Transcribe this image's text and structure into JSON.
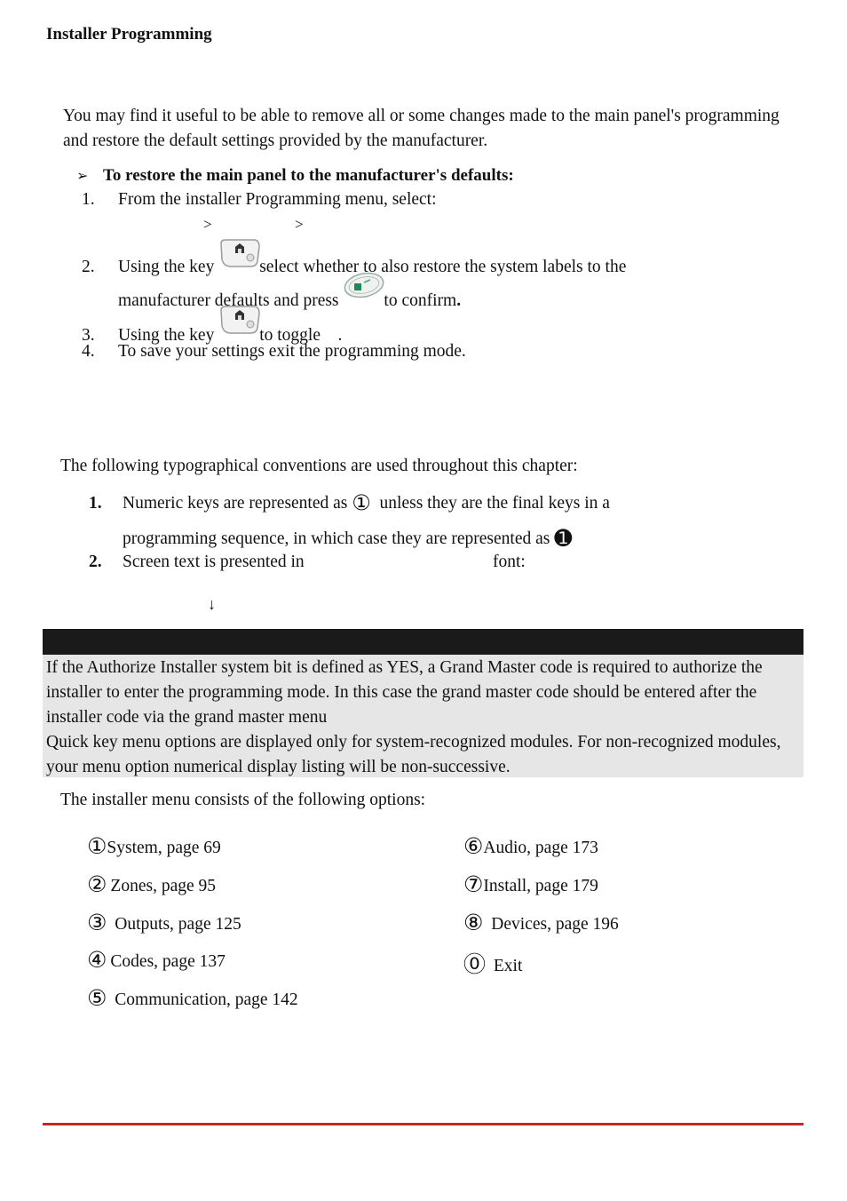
{
  "header": {
    "title": "Installer Programming"
  },
  "intro_paragraph": "You may find it useful to be able to remove all or some changes made to the main panel's programming and restore the default settings provided by the manufacturer.",
  "procedure": {
    "bullet_icon": "arrowhead-bullet",
    "bullet": "➢",
    "title": "To restore the main panel to the manufacturer's defaults:",
    "steps": [
      {
        "num": "1.",
        "text": "From the installer Programming menu, select:",
        "path_separators": [
          ">",
          ">"
        ]
      },
      {
        "num": "2.",
        "text_a": "Using the key",
        "key_icon": "home-key-icon",
        "text_b": "select whether to also restore the system labels to the",
        "text_c": "manufacturer defaults and press",
        "confirm_icon": "ok-key-icon",
        "text_d": "to confirm",
        "text_e": "."
      },
      {
        "num": "3.",
        "text_a": "Using  the key",
        "key_icon": "home-key-icon",
        "text_b": "to toggle",
        "text_c": "."
      },
      {
        "num": "4.",
        "text": "To save your settings exit the programming mode."
      }
    ]
  },
  "conventions": {
    "intro": "The following typographical conventions are used throughout this chapter:",
    "items": [
      {
        "num": "1.",
        "text_a": "Numeric keys are represented as",
        "symbol_a": "①",
        "text_b": "unless they are the final keys in a",
        "text_c": "programming sequence, in which case they are represented as",
        "symbol_b": "➊"
      },
      {
        "num": "2.",
        "text_a": "Screen text is presented in",
        "text_b": "font:"
      }
    ],
    "down_arrow": "↓"
  },
  "note": {
    "lines": [
      "If the Authorize Installer system bit is defined as YES, a Grand Master code is required to authorize the installer to enter the programming mode. In this case the grand master code should be entered after the installer code via the grand master menu",
      "Quick key menu options are displayed only for system-recognized modules. For non-recognized modules, your menu option numerical display listing will be non-successive."
    ]
  },
  "menu": {
    "intro": "The installer menu consists of the following options:",
    "left": [
      {
        "key": "①",
        "label": "System, page 69"
      },
      {
        "key": "②",
        "label": "Zones, page 95"
      },
      {
        "key": "③",
        "label": "Outputs, page 125"
      },
      {
        "key": "④",
        "label": "Codes, page 137"
      },
      {
        "key": "⑤",
        "label": "Communication, page 142"
      }
    ],
    "right": [
      {
        "key": "⑥",
        "label": "Audio, page 173"
      },
      {
        "key": "⑦",
        "label": "Install, page 179"
      },
      {
        "key": "⑧",
        "label": "Devices, page 196"
      },
      {
        "key": "⓪",
        "label": "Exit"
      }
    ]
  },
  "colors": {
    "footer_rule": "#c0282e",
    "note_bar": "#1a1a1a",
    "note_bg": "#e6e6e6"
  }
}
